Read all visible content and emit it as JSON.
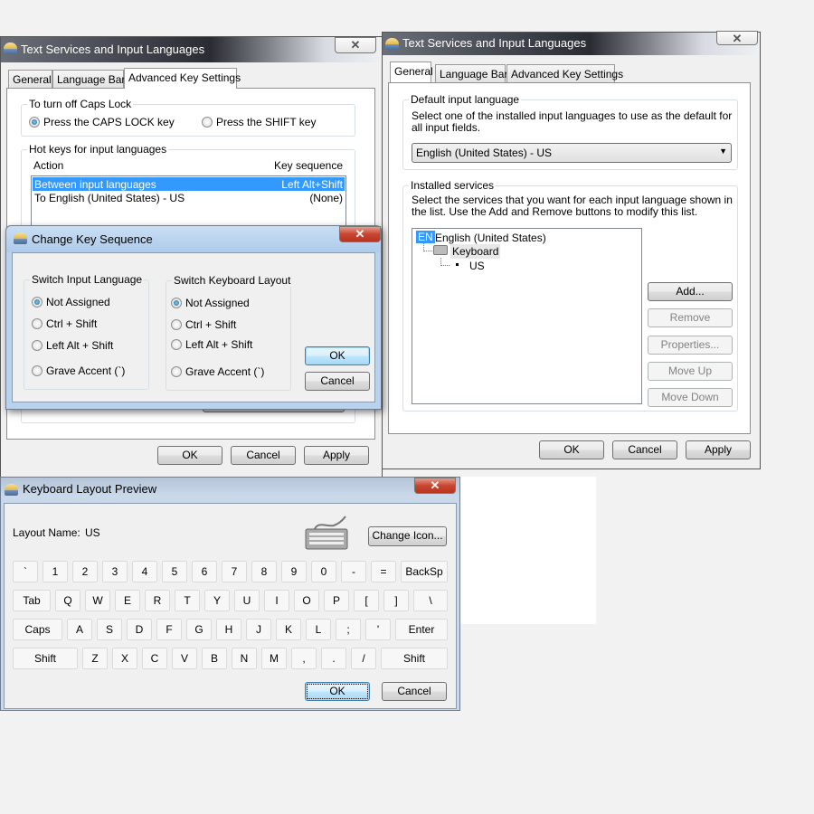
{
  "win_advanced": {
    "title": "Text Services and Input Languages",
    "tabs": [
      "General",
      "Language Bar",
      "Advanced Key Settings"
    ],
    "caps_group": "To turn off Caps Lock",
    "caps_options": [
      "Press the CAPS LOCK key",
      "Press the SHIFT key"
    ],
    "caps_selected": 0,
    "hotkeys_group": "Hot keys for input languages",
    "columns": [
      "Action",
      "Key sequence"
    ],
    "rows": [
      {
        "action": "Between input languages",
        "keys": "Left Alt+Shift",
        "selected": true
      },
      {
        "action": "To English (United States) - US",
        "keys": "(None)"
      }
    ],
    "buttons": {
      "ok": "OK",
      "cancel": "Cancel",
      "apply": "Apply"
    }
  },
  "change_key": {
    "title": "Change Key Sequence",
    "group1": "Switch Input Language",
    "group2": "Switch Keyboard Layout",
    "options": [
      "Not Assigned",
      "Ctrl + Shift",
      "Left Alt + Shift",
      "Grave Accent (`)"
    ],
    "selected1": 0,
    "selected2": 0,
    "ok": "OK",
    "cancel": "Cancel"
  },
  "win_general": {
    "title": "Text Services and Input Languages",
    "tabs": [
      "General",
      "Language Bar",
      "Advanced Key Settings"
    ],
    "default_group": "Default input language",
    "default_desc": "Select one of the installed input languages to use as the default for all input fields.",
    "default_value": "English (United States) - US",
    "services_group": "Installed services",
    "services_desc": "Select the services that you want for each input language shown in the list. Use the Add and Remove buttons to modify this list.",
    "tree": {
      "lang_badge": "EN",
      "language": "English (United States)",
      "category": "Keyboard",
      "layout": "US"
    },
    "side_buttons": {
      "add": "Add...",
      "remove": "Remove",
      "properties": "Properties...",
      "move_up": "Move Up",
      "move_down": "Move Down"
    },
    "buttons": {
      "ok": "OK",
      "cancel": "Cancel",
      "apply": "Apply"
    }
  },
  "keyboard_preview": {
    "title": "Keyboard Layout Preview",
    "layout_label": "Layout Name:",
    "layout_value": "US",
    "change_icon": "Change Icon...",
    "rows": [
      [
        "`",
        "1",
        "2",
        "3",
        "4",
        "5",
        "6",
        "7",
        "8",
        "9",
        "0",
        "-",
        "=",
        "BackSp"
      ],
      [
        "Tab",
        "Q",
        "W",
        "E",
        "R",
        "T",
        "Y",
        "U",
        "I",
        "O",
        "P",
        "[",
        "]",
        "\\"
      ],
      [
        "Caps",
        "A",
        "S",
        "D",
        "F",
        "G",
        "H",
        "J",
        "K",
        "L",
        ";",
        "'",
        "Enter"
      ],
      [
        "Shift",
        "Z",
        "X",
        "C",
        "V",
        "B",
        "N",
        "M",
        ",",
        ".",
        "/",
        "Shift"
      ]
    ],
    "ok": "OK",
    "cancel": "Cancel"
  }
}
